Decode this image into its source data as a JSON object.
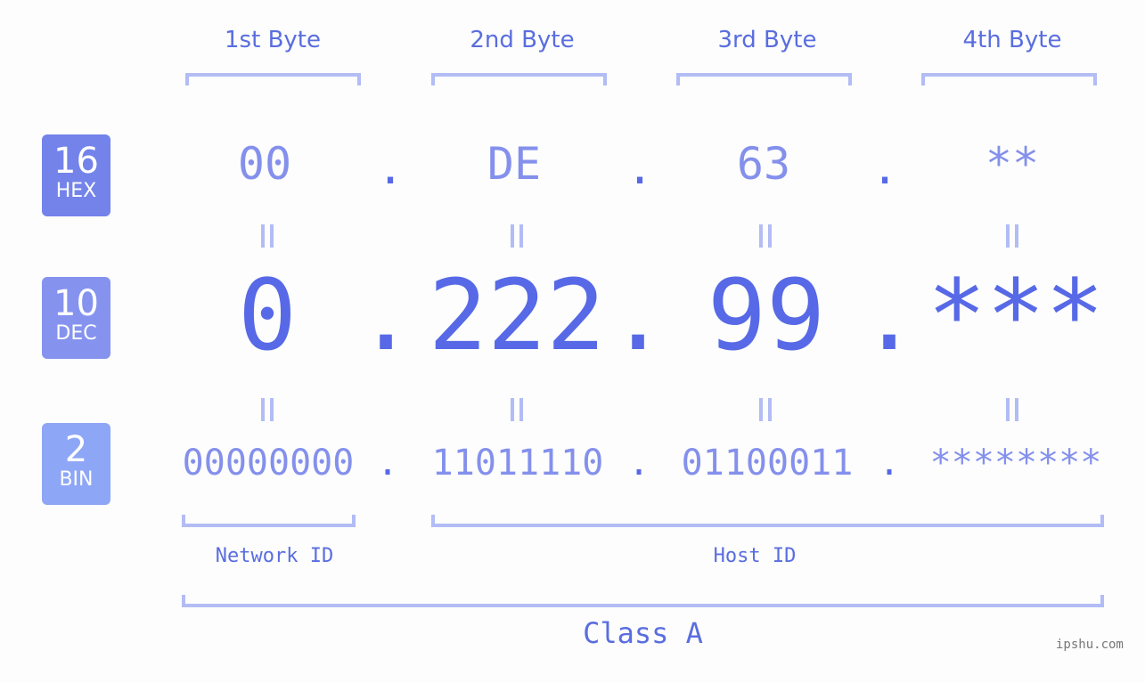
{
  "colors": {
    "hex_badge": "#7383ea",
    "dec_badge": "#8593ef",
    "bin_badge": "#8ea6f6",
    "accent": "#5769e6",
    "light_accent": "#8490ec",
    "bracket": "#b2bcf5"
  },
  "byte_headers": [
    "1st Byte",
    "2nd Byte",
    "3rd Byte",
    "4th Byte"
  ],
  "badges": {
    "hex": {
      "num": "16",
      "label": "HEX"
    },
    "dec": {
      "num": "10",
      "label": "DEC"
    },
    "bin": {
      "num": "2",
      "label": "BIN"
    }
  },
  "hex_values": [
    "00",
    "DE",
    "63",
    "**"
  ],
  "dec_values": [
    "0",
    "222",
    "99",
    "***"
  ],
  "bin_values": [
    "00000000",
    "11011110",
    "01100011",
    "********"
  ],
  "separator": ".",
  "network_id_label": "Network ID",
  "host_id_label": "Host ID",
  "class_label": "Class A",
  "watermark": "ipshu.com"
}
